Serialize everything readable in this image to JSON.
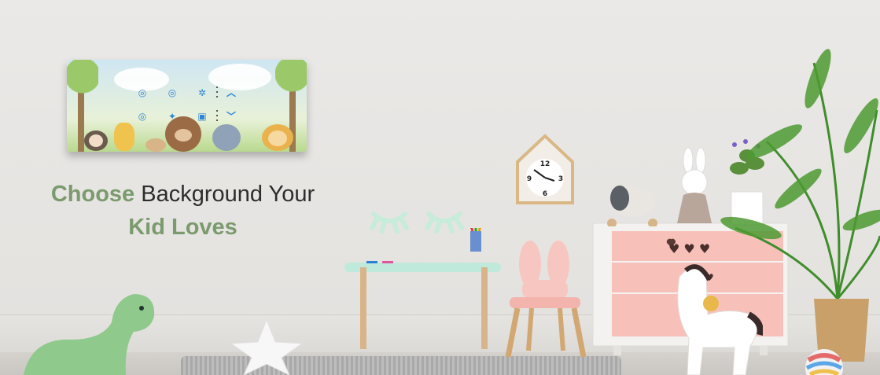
{
  "headline": {
    "line1_highlight": "Choose",
    "line1_rest": " Background Your",
    "line2_highlight": "Kid Loves"
  },
  "clock": {
    "numbers": [
      "12",
      "3",
      "6",
      "9"
    ]
  },
  "colors": {
    "accent_green": "#7b9a6e",
    "panel_control_blue": "#2e86d6",
    "dresser_pink": "#f7c1b9",
    "desk_mint": "#bfeadb"
  },
  "panel_controls": {
    "icons": [
      "light-icon",
      "light-icon",
      "fan-icon",
      "chevron-up-icon",
      "light-icon",
      "bulb-icon",
      "plug-icon",
      "chevron-down-icon"
    ]
  }
}
